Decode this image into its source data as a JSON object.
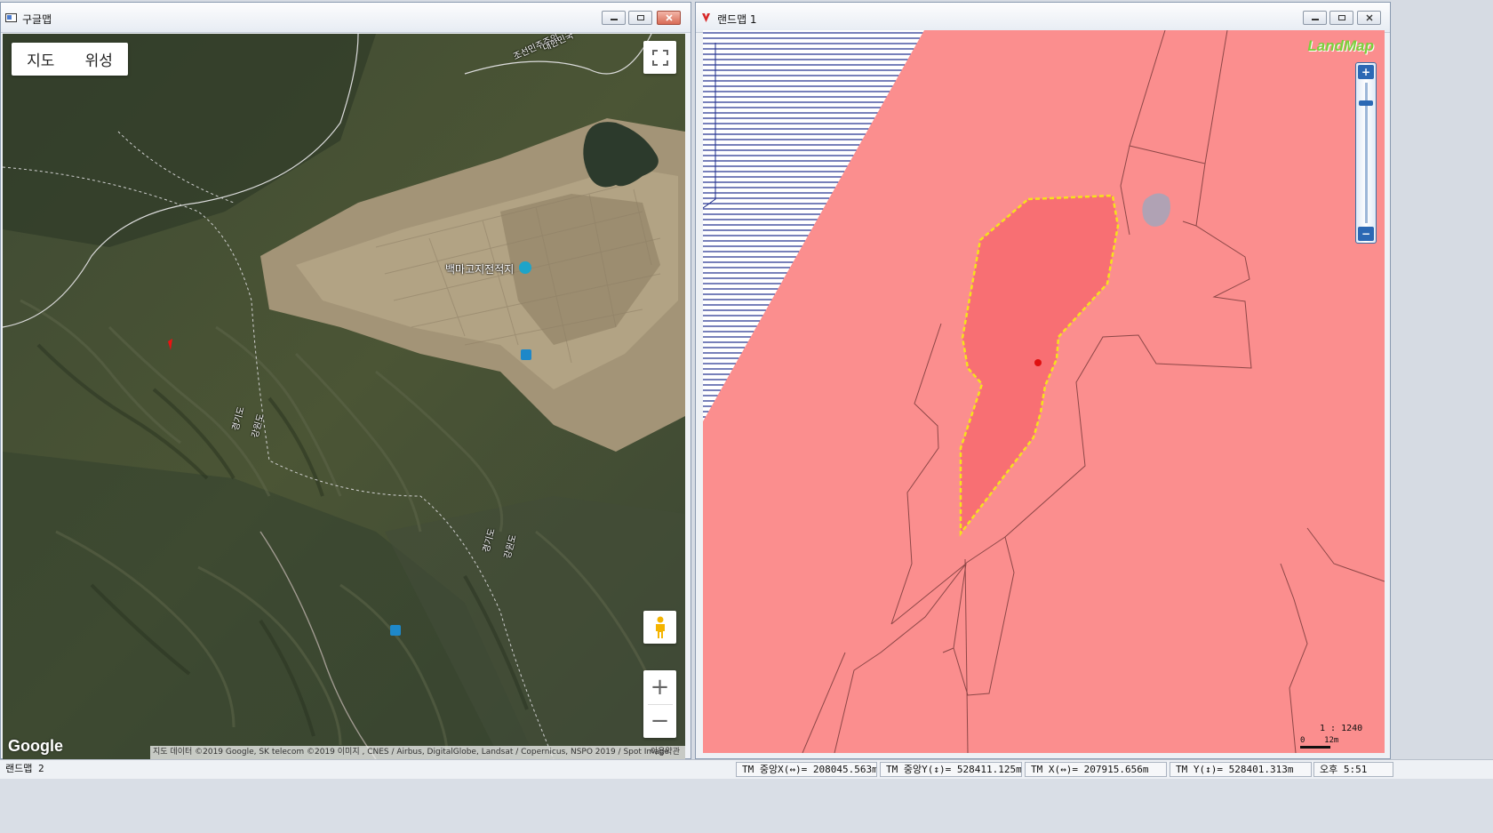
{
  "google_window": {
    "title": "구글맵",
    "maptype": {
      "map_label": "지도",
      "satellite_label": "위성"
    },
    "labels": {
      "poi": "백마고지전적지",
      "border_top_1": "조선민주주의",
      "border_top_2": "대한민국",
      "prov_a1": "경기도",
      "prov_a2": "강원도",
      "prov_b1": "경기도",
      "prov_b2": "강원도"
    },
    "zoom_in": "+",
    "zoom_out": "−",
    "logo": "Google",
    "attribution": "지도 데이터 ©2019 Google, SK telecom ©2019 이미지 , CNES / Airbus, DigitalGlobe, Landsat / Copernicus, NSPO 2019 / Spot Image",
    "terms": "이용약관"
  },
  "landmap_window": {
    "title": "랜드맵 1",
    "logo": "LandMap",
    "zoom_plus": "+",
    "zoom_minus": "−",
    "scale_ratio": "1 : 1240",
    "scale_bar": "0    12m",
    "colors": {
      "zone": "#fb8e8e",
      "parcel": "#f86f73",
      "parcel_border": "#f5e11c",
      "hatch": "#1c2c8c"
    }
  },
  "statusbar": {
    "window_name": "랜드맵 2",
    "center_x": "TM 중앙X(↔)= 208045.563m",
    "center_y": "TM 중앙Y(↕)= 528411.125m",
    "tm_x": "TM X(↔)= 207915.656m",
    "tm_y": "TM Y(↕)= 528401.313m",
    "time": "오후 5:51"
  }
}
